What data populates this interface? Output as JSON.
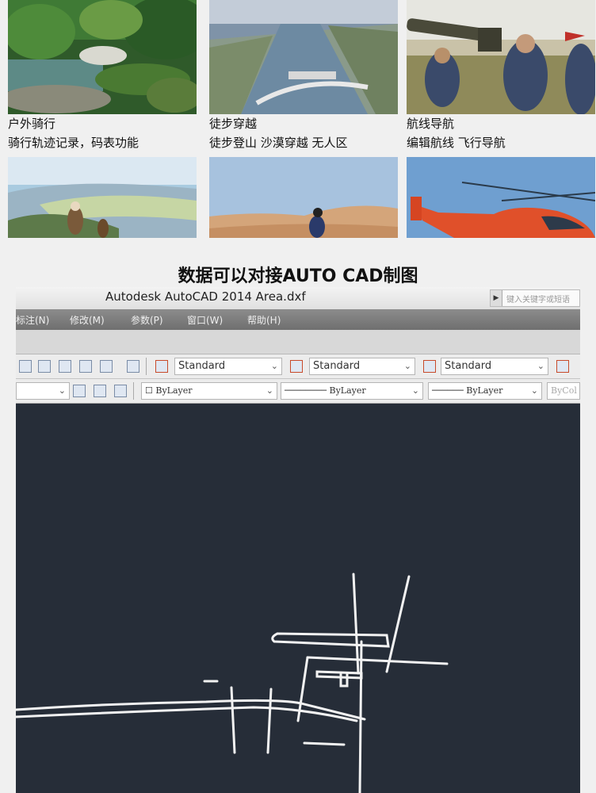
{
  "gallery": {
    "row1": [
      {
        "title": "户外骑行",
        "subtitle": "骑行轨迹记录，码表功能"
      },
      {
        "title": "徒步穿越",
        "subtitle": "徒步登山 沙漠穿越 无人区"
      },
      {
        "title": "航线导航",
        "subtitle": "编辑航线 飞行导航"
      }
    ]
  },
  "headline": "数据可以对接AUTO CAD制图",
  "cad": {
    "window_title": "Autodesk AutoCAD 2014    Area.dxf",
    "search_placeholder": "键入关键字或短语",
    "menu": [
      "标注(N)",
      "修改(M)",
      "参数(P)",
      "窗口(W)",
      "帮助(H)"
    ],
    "style_dropdowns": [
      "Standard",
      "Standard",
      "Standard"
    ],
    "layer_dropdown": "ByLayer",
    "linetype_dropdown": "ByLayer",
    "lineweight_dropdown": "ByLayer",
    "color_label": "ByCol"
  },
  "colors": {
    "cad_background": "#262d38",
    "page_background": "#f0f0f0"
  }
}
